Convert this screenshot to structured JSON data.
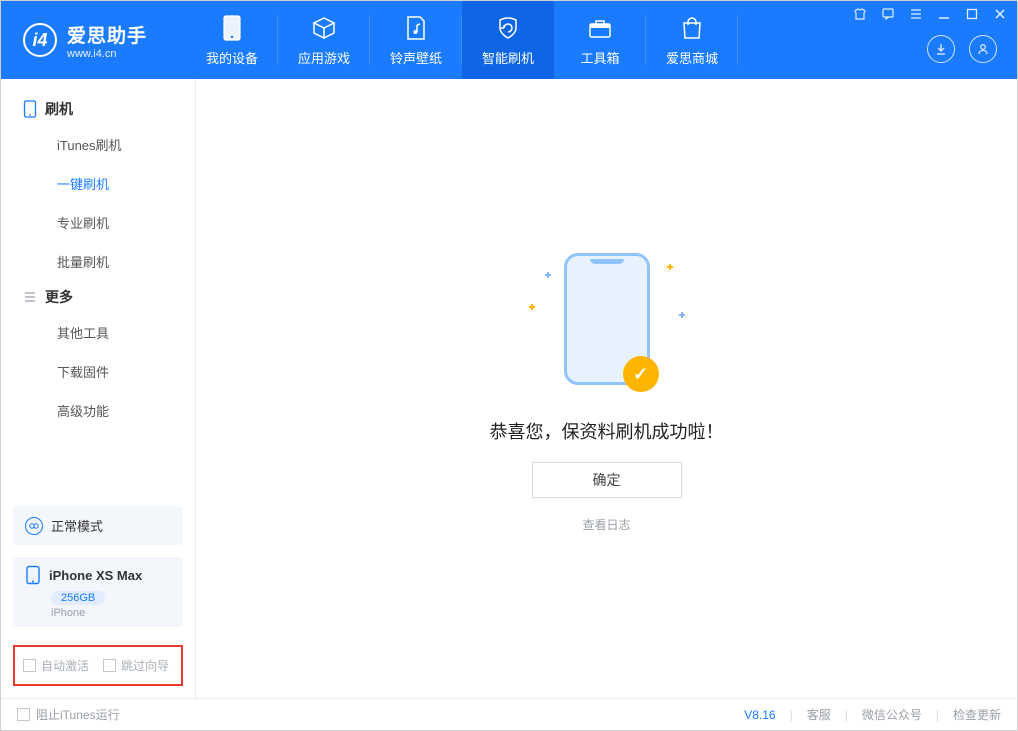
{
  "app": {
    "name": "爱思助手",
    "site": "www.i4.cn"
  },
  "header": {
    "tabs": [
      {
        "label": "我的设备"
      },
      {
        "label": "应用游戏"
      },
      {
        "label": "铃声壁纸"
      },
      {
        "label": "智能刷机"
      },
      {
        "label": "工具箱"
      },
      {
        "label": "爱思商城"
      }
    ]
  },
  "sidebar": {
    "section1": {
      "title": "刷机"
    },
    "items1": [
      {
        "label": "iTunes刷机"
      },
      {
        "label": "一键刷机"
      },
      {
        "label": "专业刷机"
      },
      {
        "label": "批量刷机"
      }
    ],
    "section2": {
      "title": "更多"
    },
    "items2": [
      {
        "label": "其他工具"
      },
      {
        "label": "下载固件"
      },
      {
        "label": "高级功能"
      }
    ],
    "mode": {
      "label": "正常模式"
    },
    "device": {
      "name": "iPhone XS Max",
      "storage": "256GB",
      "type": "iPhone"
    },
    "options": {
      "auto_activate": "自动激活",
      "skip_guide": "跳过向导"
    }
  },
  "main": {
    "success_text": "恭喜您，保资料刷机成功啦！",
    "ok": "确定",
    "view_log": "查看日志"
  },
  "footer": {
    "block_itunes": "阻止iTunes运行",
    "version": "V8.16",
    "support": "客服",
    "wechat": "微信公众号",
    "check_update": "检查更新"
  }
}
